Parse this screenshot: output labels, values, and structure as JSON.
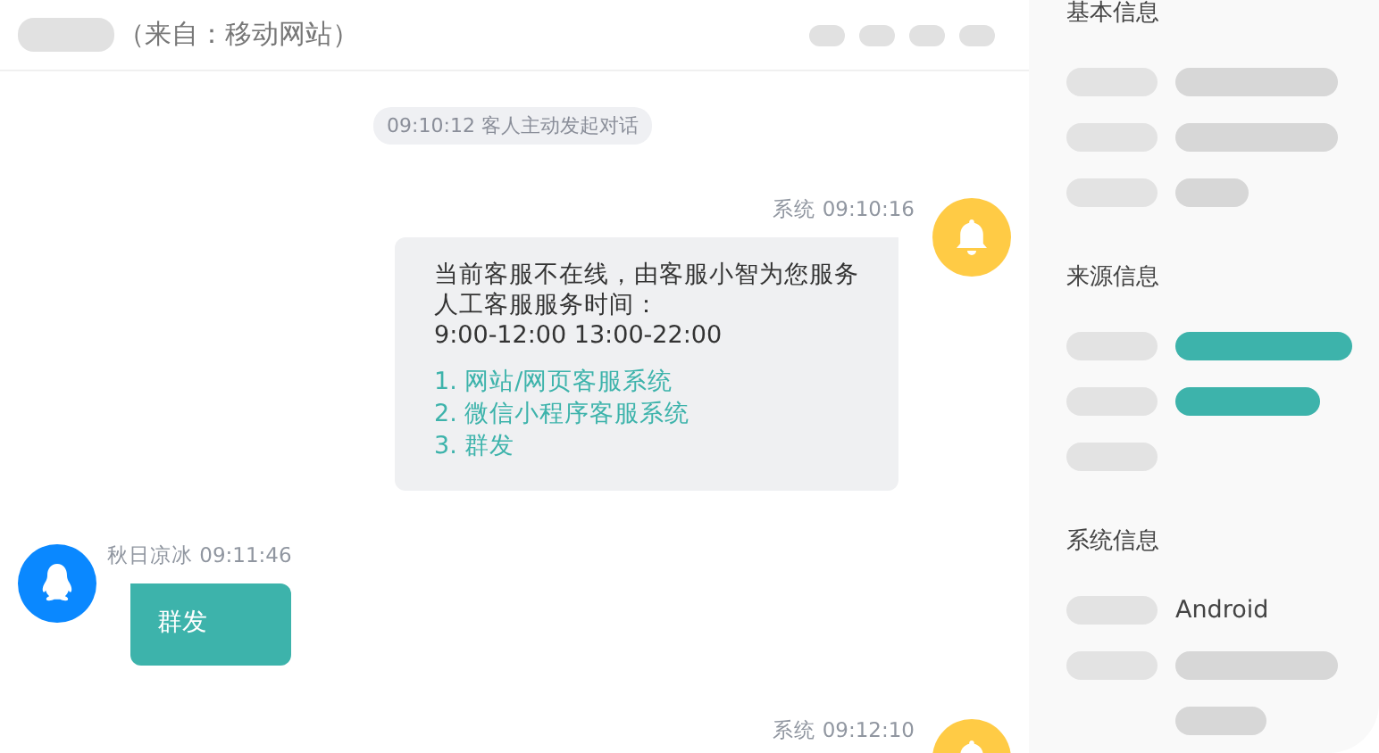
{
  "header": {
    "source": "（来自：移动网站）",
    "actions": [
      {
        "kind": "placeholder"
      },
      {
        "kind": "placeholder"
      },
      {
        "kind": "placeholder"
      },
      {
        "kind": "placeholder"
      }
    ]
  },
  "chat": [
    {
      "kind": "notice",
      "text": "09:10:12  客人主动发起对话"
    },
    {
      "kind": "system_message",
      "meta": "系统 09:10:16",
      "lines": [
        "当前客服不在线，由客服小智为您服务",
        "人工客服服务时间：",
        "9:00-12:00 13:00-22:00"
      ],
      "links": [
        "1. 网站/网页客服系统",
        "2. 微信小程序客服系统",
        "3. 群发"
      ]
    },
    {
      "kind": "visitor_message",
      "meta": "秋日凉冰 09:11:46",
      "lines": [
        "群发"
      ]
    },
    {
      "kind": "system_message",
      "meta": "系统 09:12:10"
    }
  ],
  "sidebar": {
    "sections": [
      {
        "title": "基本信息",
        "rows": [
          {
            "label": {
              "kind": "placeholder"
            },
            "value": {
              "kind": "long_placeholder"
            }
          },
          {
            "label": {
              "kind": "placeholder"
            },
            "value": {
              "kind": "long_placeholder"
            }
          },
          {
            "label": {
              "kind": "placeholder"
            },
            "value": {
              "kind": "short_placeholder"
            }
          }
        ]
      },
      {
        "title": "来源信息",
        "rows": [
          {
            "label": {
              "kind": "placeholder"
            },
            "value": {
              "kind": "full_bar",
              "color": "#3db3ab"
            }
          },
          {
            "label": {
              "kind": "placeholder"
            },
            "value": {
              "kind": "medium_bar",
              "color": "#3db3ab"
            }
          },
          {
            "label": {
              "kind": "placeholder"
            }
          }
        ]
      },
      {
        "title": "系统信息",
        "rows": [
          {
            "label": {
              "kind": "placeholder"
            },
            "value": {
              "kind": "text",
              "text": "Android"
            }
          },
          {
            "label": {
              "kind": "placeholder"
            },
            "value": {
              "kind": "long_placeholder"
            }
          },
          {
            "value": {
              "kind": "mid_placeholder"
            }
          }
        ]
      }
    ]
  }
}
